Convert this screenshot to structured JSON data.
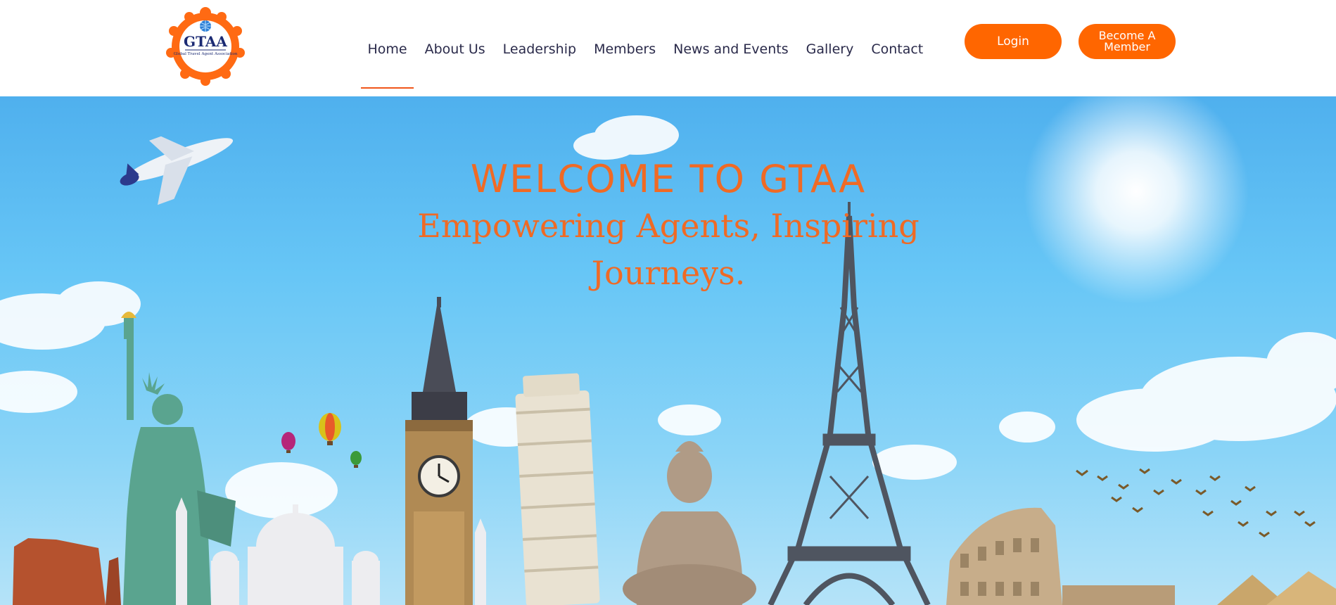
{
  "header": {
    "logo": {
      "name": "GTAA",
      "tagline": "Global Travel Agent Association"
    },
    "nav": [
      {
        "label": "Home",
        "active": true
      },
      {
        "label": "About Us"
      },
      {
        "label": "Leadership"
      },
      {
        "label": "Members"
      },
      {
        "label": "News and Events"
      },
      {
        "label": "Gallery"
      },
      {
        "label": "Contact"
      }
    ],
    "login_label": "Login",
    "member_label": "Become A Member"
  },
  "hero": {
    "title": "WELCOME TO GTAA",
    "subtitle": "Empowering Agents, Inspiring Journeys."
  },
  "colors": {
    "accent": "#ff6600",
    "hero_text": "#ef6a25",
    "nav_text": "#2a2a4a",
    "sky": "#67c6f6"
  },
  "icons": {
    "logo": "globe-people-ring-logo"
  }
}
